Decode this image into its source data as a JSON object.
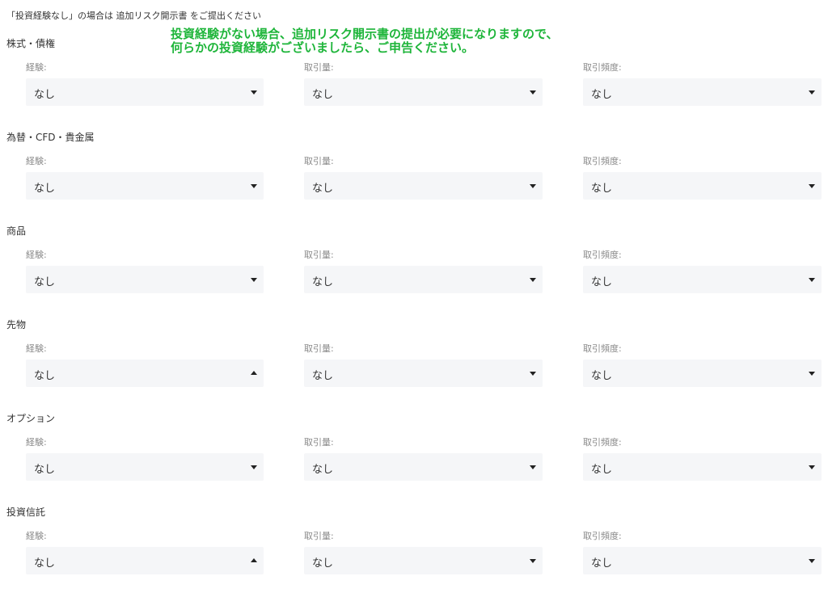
{
  "notice": "「投資経験なし」の場合は 追加リスク開示書 をご提出ください",
  "annotation": {
    "line1": "投資経験がない場合、追加リスク開示書の提出が必要になりますので、",
    "line2": "何らかの投資経験がございましたら、ご申告ください。",
    "color": "#1eb53a"
  },
  "labels": {
    "experience": "経験:",
    "volume": "取引量:",
    "frequency": "取引頻度:"
  },
  "sections": [
    {
      "title": "株式・債権",
      "experience": {
        "value": "なし",
        "arrow": "chevron-down-icon"
      },
      "volume": {
        "value": "なし",
        "arrow": "chevron-down-icon"
      },
      "frequency": {
        "value": "なし",
        "arrow": "chevron-down-icon"
      }
    },
    {
      "title": "為替・CFD・貴金属",
      "experience": {
        "value": "なし",
        "arrow": "chevron-down-icon"
      },
      "volume": {
        "value": "なし",
        "arrow": "chevron-down-icon"
      },
      "frequency": {
        "value": "なし",
        "arrow": "chevron-down-icon"
      }
    },
    {
      "title": "商品",
      "experience": {
        "value": "なし",
        "arrow": "chevron-down-icon"
      },
      "volume": {
        "value": "なし",
        "arrow": "chevron-down-icon"
      },
      "frequency": {
        "value": "なし",
        "arrow": "chevron-down-icon"
      }
    },
    {
      "title": "先物",
      "experience": {
        "value": "なし",
        "arrow": "chevron-up-icon"
      },
      "volume": {
        "value": "なし",
        "arrow": "chevron-down-icon"
      },
      "frequency": {
        "value": "なし",
        "arrow": "chevron-down-icon"
      }
    },
    {
      "title": "オプション",
      "experience": {
        "value": "なし",
        "arrow": "chevron-down-icon"
      },
      "volume": {
        "value": "なし",
        "arrow": "chevron-down-icon"
      },
      "frequency": {
        "value": "なし",
        "arrow": "chevron-down-icon"
      }
    },
    {
      "title": "投資信託",
      "experience": {
        "value": "なし",
        "arrow": "chevron-up-icon"
      },
      "volume": {
        "value": "なし",
        "arrow": "chevron-down-icon"
      },
      "frequency": {
        "value": "なし",
        "arrow": "chevron-down-icon"
      }
    }
  ]
}
